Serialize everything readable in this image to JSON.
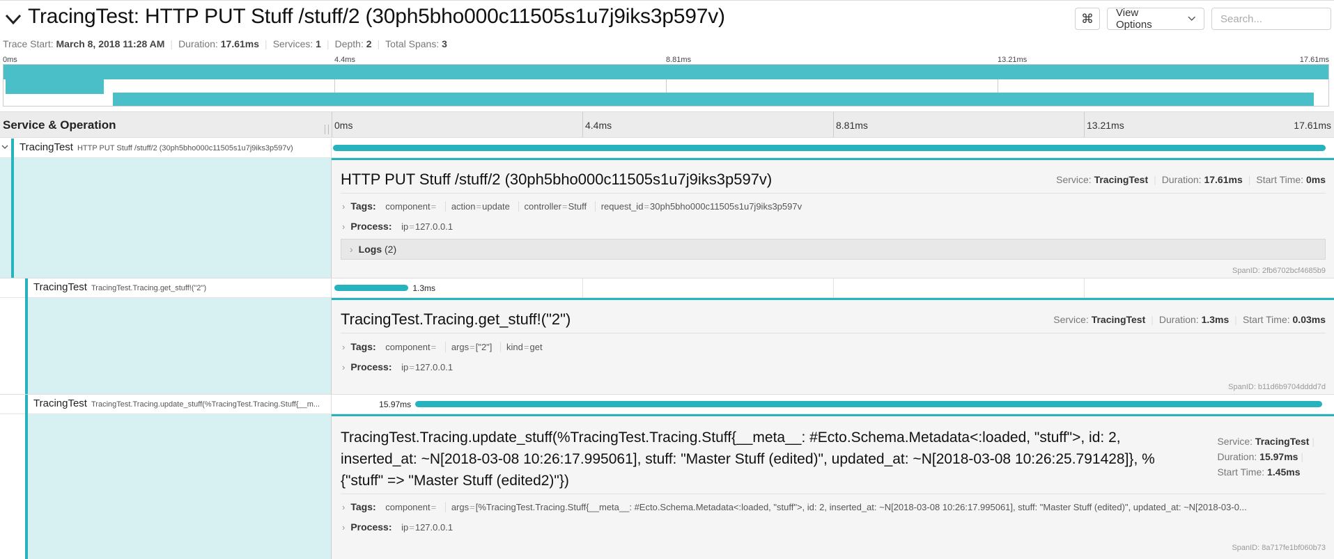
{
  "header": {
    "title": "TracingTest: HTTP PUT Stuff /stuff/2 (30ph5bho000c11505s1u7j9iks3p597v)",
    "kbd_icon": "⌘",
    "view_options_label": "View Options",
    "search_placeholder": "Search..."
  },
  "trace_meta": {
    "start_label": "Trace Start:",
    "start_value": "March 8, 2018 11:28 AM",
    "duration_label": "Duration:",
    "duration_value": "17.61ms",
    "services_label": "Services:",
    "services_value": "1",
    "depth_label": "Depth:",
    "depth_value": "2",
    "spans_label": "Total Spans:",
    "spans_value": "3"
  },
  "minimap": {
    "ticks": [
      "0ms",
      "4.4ms",
      "8.81ms",
      "13.21ms",
      "17.61ms"
    ]
  },
  "table": {
    "column_label": "Service & Operation",
    "ticks": [
      "0ms",
      "4.4ms",
      "8.81ms",
      "13.21ms",
      "17.61ms"
    ]
  },
  "total_duration_ms": 17.61,
  "spans": [
    {
      "service": "TracingTest",
      "operation": "HTTP PUT Stuff /stuff/2 (30ph5bho000c11505s1u7j9iks3p597v)",
      "start_ms": 0,
      "duration_ms": 17.61,
      "detail": {
        "title": "HTTP PUT Stuff /stuff/2 (30ph5bho000c11505s1u7j9iks3p597v)",
        "service_label": "Service:",
        "service": "TracingTest",
        "duration_label": "Duration:",
        "duration": "17.61ms",
        "start_label": "Start Time:",
        "start": "0ms",
        "tags_label": "Tags:",
        "tags": [
          {
            "k": "component",
            "v": ""
          },
          {
            "k": "action",
            "v": "update"
          },
          {
            "k": "controller",
            "v": "Stuff"
          },
          {
            "k": "request_id",
            "v": "30ph5bho000c11505s1u7j9iks3p597v"
          }
        ],
        "process_label": "Process:",
        "process": [
          {
            "k": "ip",
            "v": "127.0.0.1"
          }
        ],
        "logs_label": "Logs",
        "logs_count": "(2)",
        "span_id": "SpanID: 2fb6702bcf4685b9"
      }
    },
    {
      "service": "TracingTest",
      "operation": "TracingTest.Tracing.get_stuff!(\"2\")",
      "start_ms": 0.03,
      "duration_ms": 1.3,
      "bar_label": "1.3ms",
      "detail": {
        "title": "TracingTest.Tracing.get_stuff!(\"2\")",
        "service_label": "Service:",
        "service": "TracingTest",
        "duration_label": "Duration:",
        "duration": "1.3ms",
        "start_label": "Start Time:",
        "start": "0.03ms",
        "tags_label": "Tags:",
        "tags": [
          {
            "k": "component",
            "v": ""
          },
          {
            "k": "args",
            "v": "[\"2\"]"
          },
          {
            "k": "kind",
            "v": "get"
          }
        ],
        "process_label": "Process:",
        "process": [
          {
            "k": "ip",
            "v": "127.0.0.1"
          }
        ],
        "span_id": "SpanID: b11d6b9704dddd7d"
      }
    },
    {
      "service": "TracingTest",
      "operation": "TracingTest.Tracing.update_stuff(%TracingTest.Tracing.Stuff{__m...",
      "start_ms": 1.45,
      "duration_ms": 15.97,
      "bar_label": "15.97ms",
      "detail": {
        "title": "TracingTest.Tracing.update_stuff(%TracingTest.Tracing.Stuff{__meta__: #Ecto.Schema.Metadata<:loaded, \"stuff\">, id: 2, inserted_at: ~N[2018-03-08 10:26:17.995061], stuff: \"Master Stuff (edited)\", updated_at: ~N[2018-03-08 10:26:25.791428]}, %{\"stuff\" => \"Master Stuff (edited2)\"})",
        "service_label": "Service:",
        "service": "TracingTest",
        "duration_label": "Duration:",
        "duration": "15.97ms",
        "start_label": "Start Time:",
        "start": "1.45ms",
        "tags_label": "Tags:",
        "tags": [
          {
            "k": "component",
            "v": ""
          },
          {
            "k": "args",
            "v": "[%TracingTest.Tracing.Stuff{__meta__: #Ecto.Schema.Metadata<:loaded, \"stuff\">, id: 2, inserted_at: ~N[2018-03-08 10:26:17.995061], stuff: \"Master Stuff (edited)\", updated_at: ~N[2018-03-0..."
          }
        ],
        "process_label": "Process:",
        "process": [
          {
            "k": "ip",
            "v": "127.0.0.1"
          }
        ],
        "span_id": "SpanID: 8a717fe1bf060b73"
      }
    }
  ],
  "colors": {
    "span_bar": "#26b3bd",
    "minimap_bar": "#4bbfc8",
    "detail_left_bg": "#d7f0f2"
  }
}
